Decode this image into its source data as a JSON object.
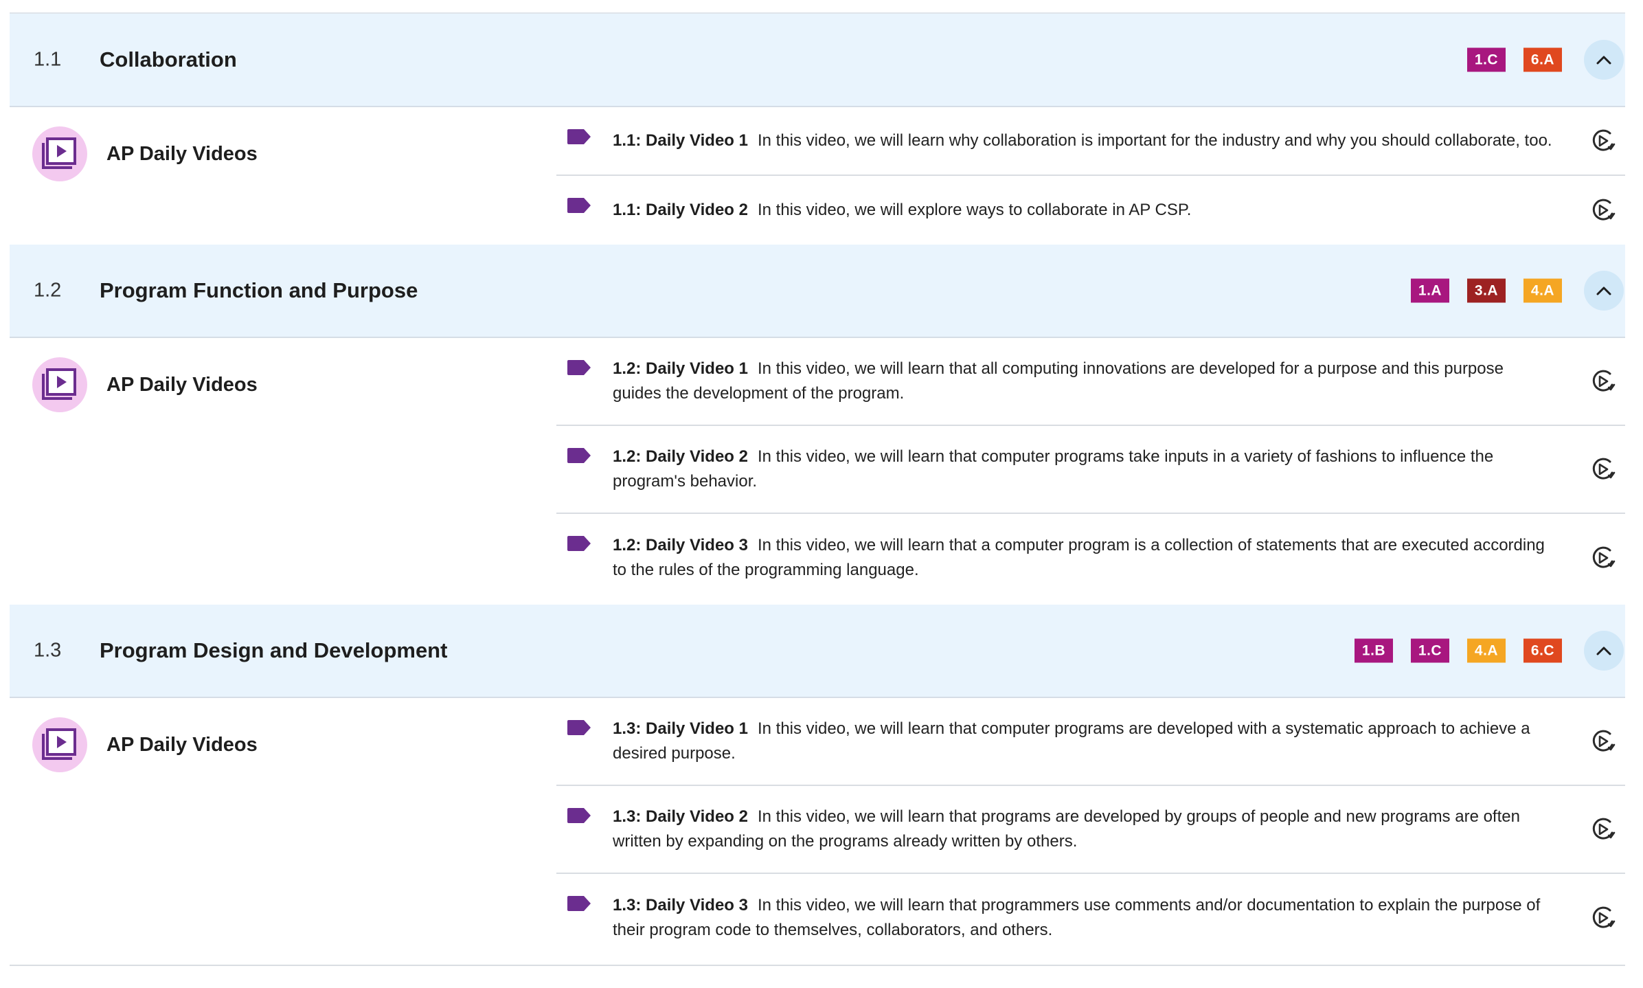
{
  "colors": {
    "header_bg": "#e9f4fd",
    "magenta": "#a8177f",
    "maroon": "#9d2222",
    "orange_red": "#e0481f",
    "amber": "#f5a623",
    "purple": "#6b2d8f"
  },
  "topics": [
    {
      "number": "1.1",
      "title": "Collaboration",
      "skills": [
        {
          "code": "1.C",
          "color": "#a8177f"
        },
        {
          "code": "6.A",
          "color": "#e0481f"
        }
      ],
      "toggle_icon": "chevron-up-icon",
      "resource": {
        "label": "AP Daily Videos",
        "icon": "video-playlist-icon"
      },
      "videos": [
        {
          "title": "1.1: Daily Video 1",
          "description": "In this video, we will learn why collaboration is important for the industry and why you should collaborate, too."
        },
        {
          "title": "1.1: Daily Video 2",
          "description": "In this video, we will explore ways to collaborate in AP CSP."
        }
      ]
    },
    {
      "number": "1.2",
      "title": "Program Function and Purpose",
      "skills": [
        {
          "code": "1.A",
          "color": "#a8177f"
        },
        {
          "code": "3.A",
          "color": "#9d2222"
        },
        {
          "code": "4.A",
          "color": "#f5a623"
        }
      ],
      "toggle_icon": "chevron-up-icon",
      "resource": {
        "label": "AP Daily Videos",
        "icon": "video-playlist-icon"
      },
      "videos": [
        {
          "title": "1.2: Daily Video 1",
          "description": "In this video, we will learn that all computing innovations are developed for a purpose and this purpose guides the development of the program."
        },
        {
          "title": "1.2: Daily Video 2",
          "description": "In this video, we will learn that computer programs take inputs in a variety of fashions to influence the program's behavior."
        },
        {
          "title": "1.2: Daily Video 3",
          "description": "In this video, we will learn that a computer program is a collection of statements that are executed according to the rules of the programming language."
        }
      ]
    },
    {
      "number": "1.3",
      "title": "Program Design and Development",
      "skills": [
        {
          "code": "1.B",
          "color": "#a8177f"
        },
        {
          "code": "1.C",
          "color": "#a8177f"
        },
        {
          "code": "4.A",
          "color": "#f5a623"
        },
        {
          "code": "6.C",
          "color": "#e0481f"
        }
      ],
      "toggle_icon": "chevron-up-icon",
      "resource": {
        "label": "AP Daily Videos",
        "icon": "video-playlist-icon"
      },
      "videos": [
        {
          "title": "1.3: Daily Video 1",
          "description": "In this video, we will learn that computer programs are developed with a systematic approach to achieve a desired purpose."
        },
        {
          "title": "1.3: Daily Video 2",
          "description": "In this video, we will learn that programs are developed by groups of people and new programs are often written by expanding on the programs already written by others."
        },
        {
          "title": "1.3: Daily Video 3",
          "description": "In this video, we will learn that programmers use comments and/or documentation to explain the purpose of their program code to themselves, collaborators, and others."
        }
      ]
    }
  ]
}
